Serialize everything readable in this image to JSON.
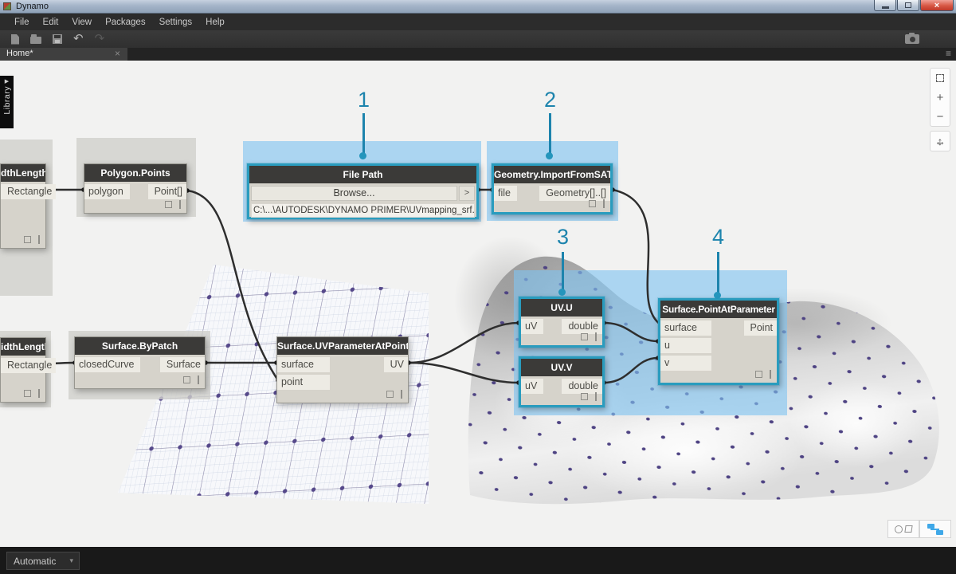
{
  "window": {
    "title": "Dynamo",
    "close_glyph": "×"
  },
  "menu": {
    "items": [
      "File",
      "Edit",
      "View",
      "Packages",
      "Settings",
      "Help"
    ]
  },
  "toolbar": {
    "undo_glyph": "↶",
    "redo_glyph": "↷"
  },
  "tabbar": {
    "home_tab": "Home*",
    "close_glyph": "×",
    "overflow_glyph": "≡"
  },
  "library": {
    "label": "Library",
    "expand_glyph": "▶"
  },
  "callouts": {
    "c1": "1",
    "c2": "2",
    "c3": "3",
    "c4": "4"
  },
  "nodes": {
    "rect_top": {
      "title": "dthLength",
      "out": "Rectangle"
    },
    "rect_bottom": {
      "title": "idthLength",
      "out": "Rectangle"
    },
    "polygon_points": {
      "title": "Polygon.Points",
      "in": "polygon",
      "out": "Point[]"
    },
    "file_path": {
      "title": "File Path",
      "browse": "Browse...",
      "chevron": ">",
      "path": "C:\\...\\AUTODESK\\DYNAMO PRIMER\\UVmapping_srf.sat"
    },
    "import_sat": {
      "title": "Geometry.ImportFromSAT",
      "in": "file",
      "out": "Geometry[]..[]"
    },
    "by_patch": {
      "title": "Surface.ByPatch",
      "in": "closedCurve",
      "out": "Surface"
    },
    "uv_param": {
      "title": "Surface.UVParameterAtPoint",
      "in1": "surface",
      "in2": "point",
      "out": "UV"
    },
    "uv_u": {
      "title": "UV.U",
      "in": "uV",
      "out": "double"
    },
    "uv_v": {
      "title": "UV.V",
      "in": "uV",
      "out": "double"
    },
    "point_at_param": {
      "title": "Surface.PointAtParameter",
      "in1": "surface",
      "in2": "u",
      "in3": "v",
      "out": "Point"
    }
  },
  "canvas_controls": {
    "zoom_in": "+",
    "zoom_out": "−",
    "pan_h": "↔",
    "pan_v": "↕"
  },
  "statusbar": {
    "run_mode": "Automatic",
    "caret": "▾"
  },
  "colors": {
    "selection": "#2a9cbe",
    "highlight": "#80c4f0",
    "callout": "#1d84ad"
  }
}
